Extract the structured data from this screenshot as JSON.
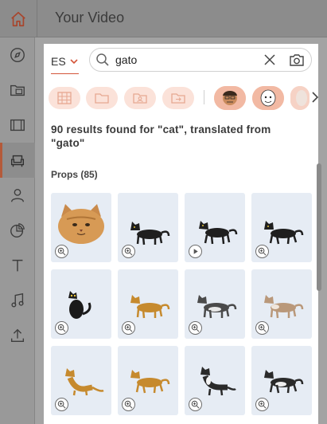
{
  "app": {
    "title": "Your Video"
  },
  "rail": {
    "items": [
      {
        "name": "compass-icon"
      },
      {
        "name": "media-folder-icon"
      },
      {
        "name": "film-icon"
      },
      {
        "name": "armchair-icon",
        "active": true
      },
      {
        "name": "person-icon"
      },
      {
        "name": "chart-pie-icon"
      },
      {
        "name": "text-icon"
      },
      {
        "name": "music-note-icon"
      },
      {
        "name": "upload-icon"
      }
    ]
  },
  "search": {
    "language": "ES",
    "query": "gato",
    "placeholder": ""
  },
  "filters": {
    "buttons": [
      "grid-icon",
      "folder-icon",
      "user-folder-icon",
      "export-folder-icon"
    ],
    "chips": [
      "character-man-icon",
      "character-ghost-icon",
      "character-partial-icon"
    ]
  },
  "results": {
    "summary": "90 results found for \"cat\", translated from \"gato\"",
    "section_title": "Props (85)"
  },
  "tiles": [
    {
      "name": "cat-face-prop",
      "badge": "zoom"
    },
    {
      "name": "black-cat-prop",
      "badge": "zoom"
    },
    {
      "name": "black-cat-animated-prop",
      "badge": "play"
    },
    {
      "name": "black-cat-walking-prop",
      "badge": "zoom"
    },
    {
      "name": "black-cat-sitting-prop",
      "badge": "zoom"
    },
    {
      "name": "orange-cat-prop",
      "badge": "zoom"
    },
    {
      "name": "gray-cat-prop",
      "badge": "zoom"
    },
    {
      "name": "tan-cat-prop",
      "badge": "zoom"
    },
    {
      "name": "orange-cat-standing-prop",
      "badge": "zoom"
    },
    {
      "name": "orange-cat-walking-prop",
      "badge": "zoom"
    },
    {
      "name": "tuxedo-cat-prop",
      "badge": "zoom"
    },
    {
      "name": "tuxedo-cat-walking-prop",
      "badge": "zoom"
    }
  ],
  "colors": {
    "accent": "#d4553a",
    "chip_bg": "#fbe2d9",
    "tile_bg": "#e6ecf4"
  }
}
